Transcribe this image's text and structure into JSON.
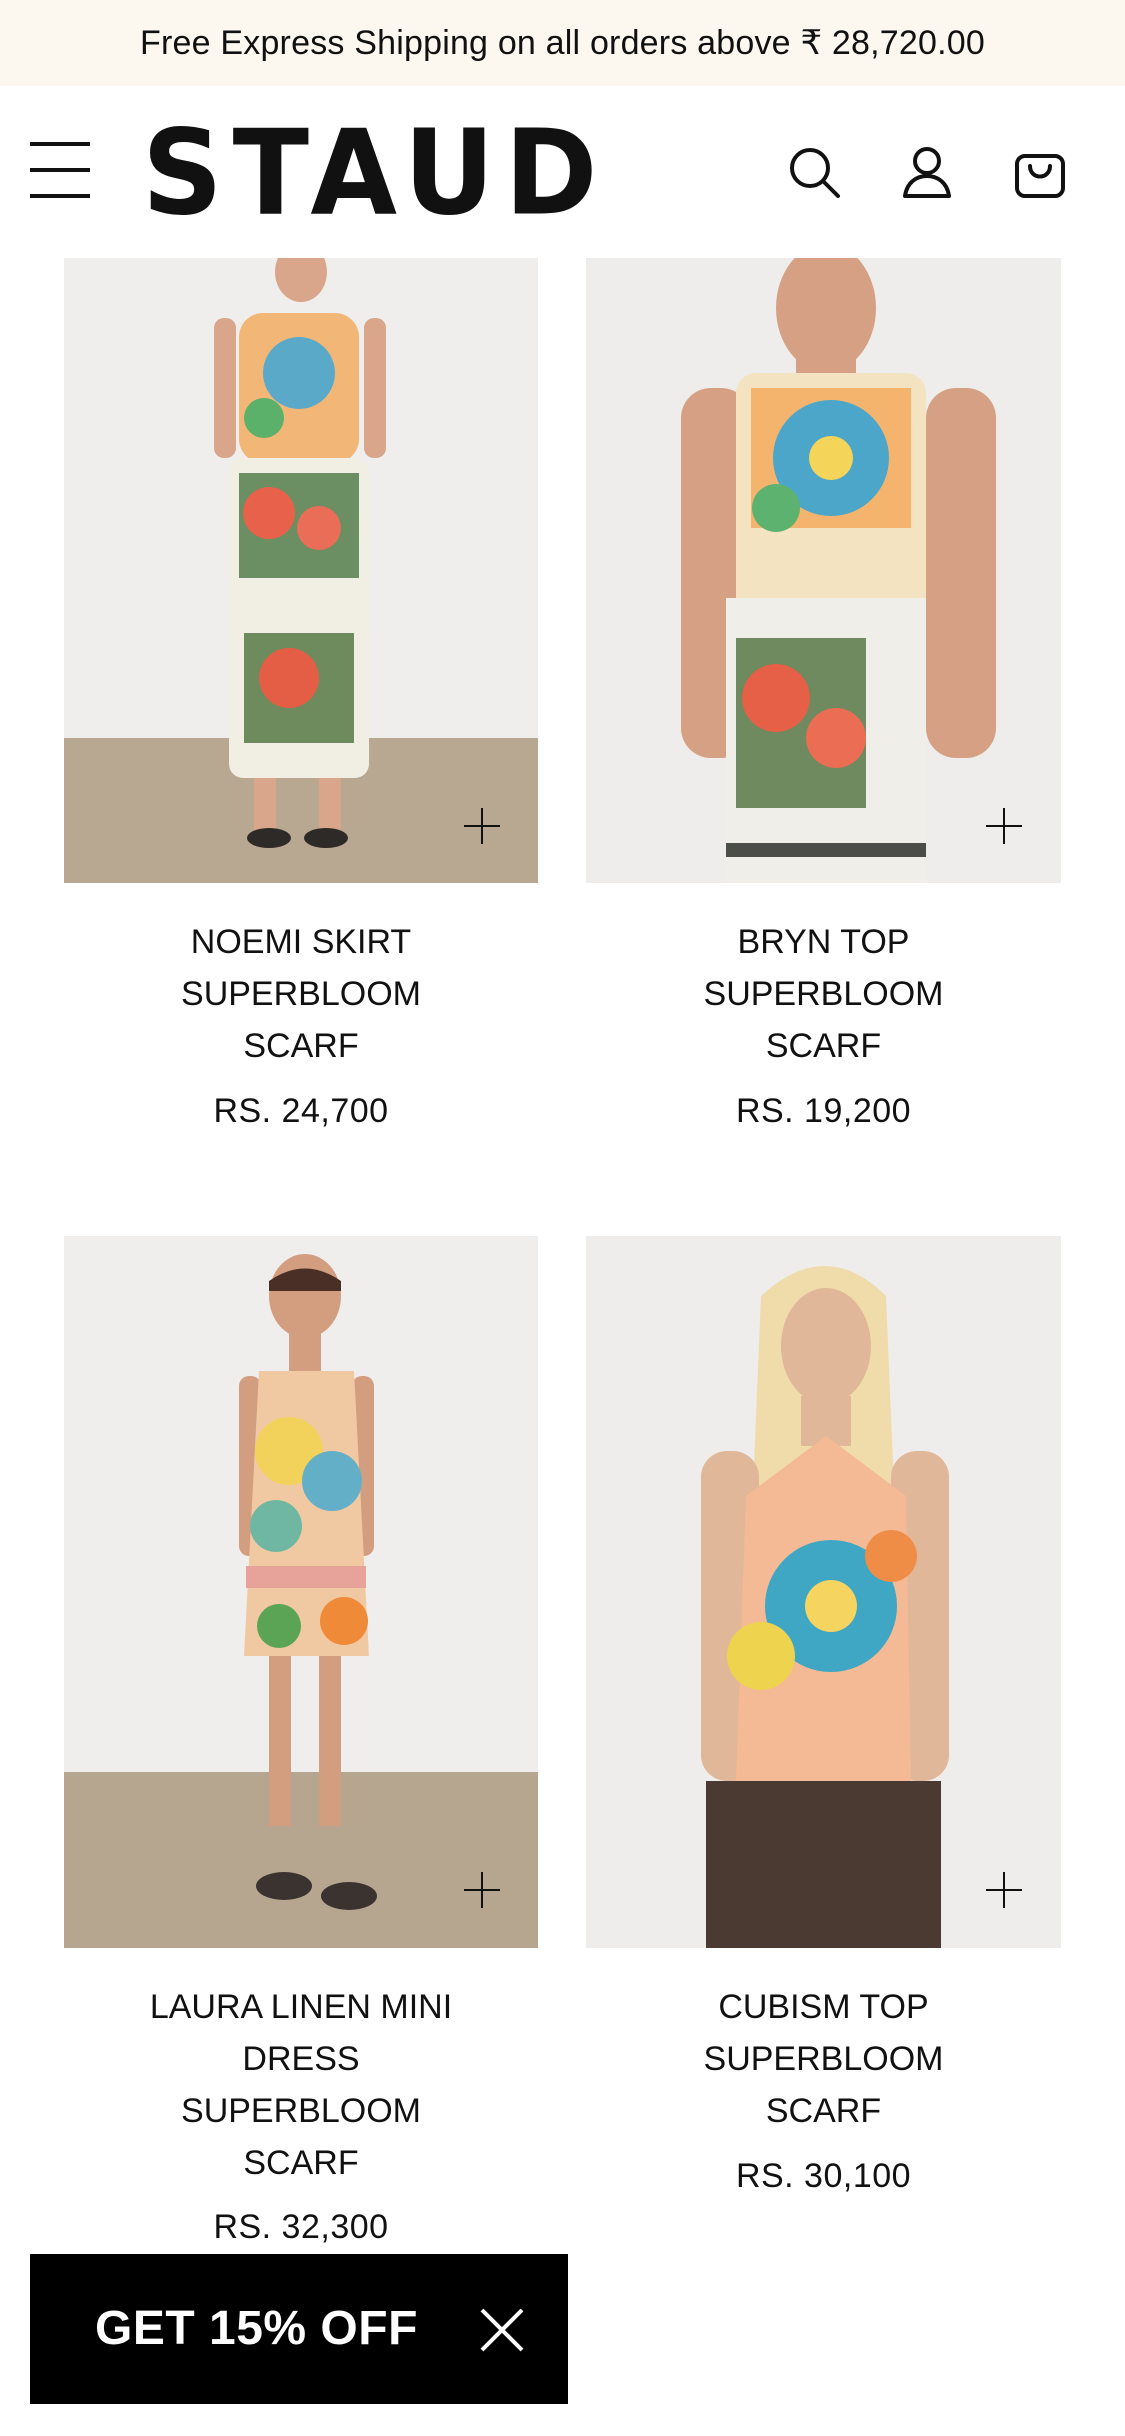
{
  "banner": {
    "text": "Free Express Shipping on all orders above ₹ 28,720.00"
  },
  "header": {
    "logo": "STAUD",
    "icons": [
      "menu-icon",
      "search-icon",
      "account-icon",
      "cart-icon"
    ]
  },
  "products": [
    {
      "name_lines": [
        "NOEMI SKIRT",
        "SUPERBLOOM",
        "SCARF"
      ],
      "price": "RS. 24,700"
    },
    {
      "name_lines": [
        "BRYN TOP",
        "SUPERBLOOM",
        "SCARF"
      ],
      "price": "RS. 19,200"
    },
    {
      "name_lines": [
        "LAURA LINEN MINI",
        "DRESS",
        "SUPERBLOOM",
        "SCARF"
      ],
      "price": "RS. 32,300"
    },
    {
      "name_lines": [
        "CUBISM TOP",
        "SUPERBLOOM",
        "SCARF"
      ],
      "price": "RS. 30,100"
    }
  ],
  "promo": {
    "label": "GET 15% OFF"
  },
  "colors": {
    "banner_bg": "#fcf8ef",
    "text": "#111111",
    "promo_bg": "#000000"
  }
}
